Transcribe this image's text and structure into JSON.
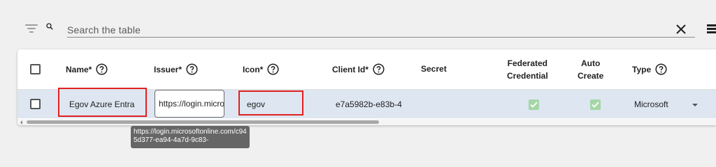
{
  "search": {
    "placeholder": "Search the table",
    "value": ""
  },
  "icons": {
    "filter": "filter-icon",
    "search": "search-icon",
    "clear": "close-icon",
    "columns_menu": "menu-icon",
    "help": "help-circle-icon",
    "checked": "check-icon",
    "dropdown": "caret-down-icon"
  },
  "colors": {
    "row_highlight": "#dde6f1",
    "annotation_border": "#e02020",
    "check_green": "#a5d6a7"
  },
  "table": {
    "headers": {
      "name": "Name*",
      "issuer": "Issuer*",
      "icon": "Icon*",
      "client_id": "Client Id*",
      "secret": "Secret",
      "federated_line1": "Federated",
      "federated_line2": "Credential",
      "auto_line1": "Auto",
      "auto_line2": "Create",
      "type": "Type"
    },
    "rows": [
      {
        "name": "Egov Azure Entra",
        "issuer": "https://login.microsoftonline.com/c945d377-ea94-4a7d-9c83-",
        "icon": "egov",
        "client_id": "e7a5982b-e83b-4",
        "secret": "",
        "federated_credential": true,
        "auto_create": true,
        "type": "Microsoft"
      }
    ]
  },
  "tooltip": {
    "text": "https://login.microsoftonline.com/c945d377-ea94-4a7d-9c83-"
  }
}
